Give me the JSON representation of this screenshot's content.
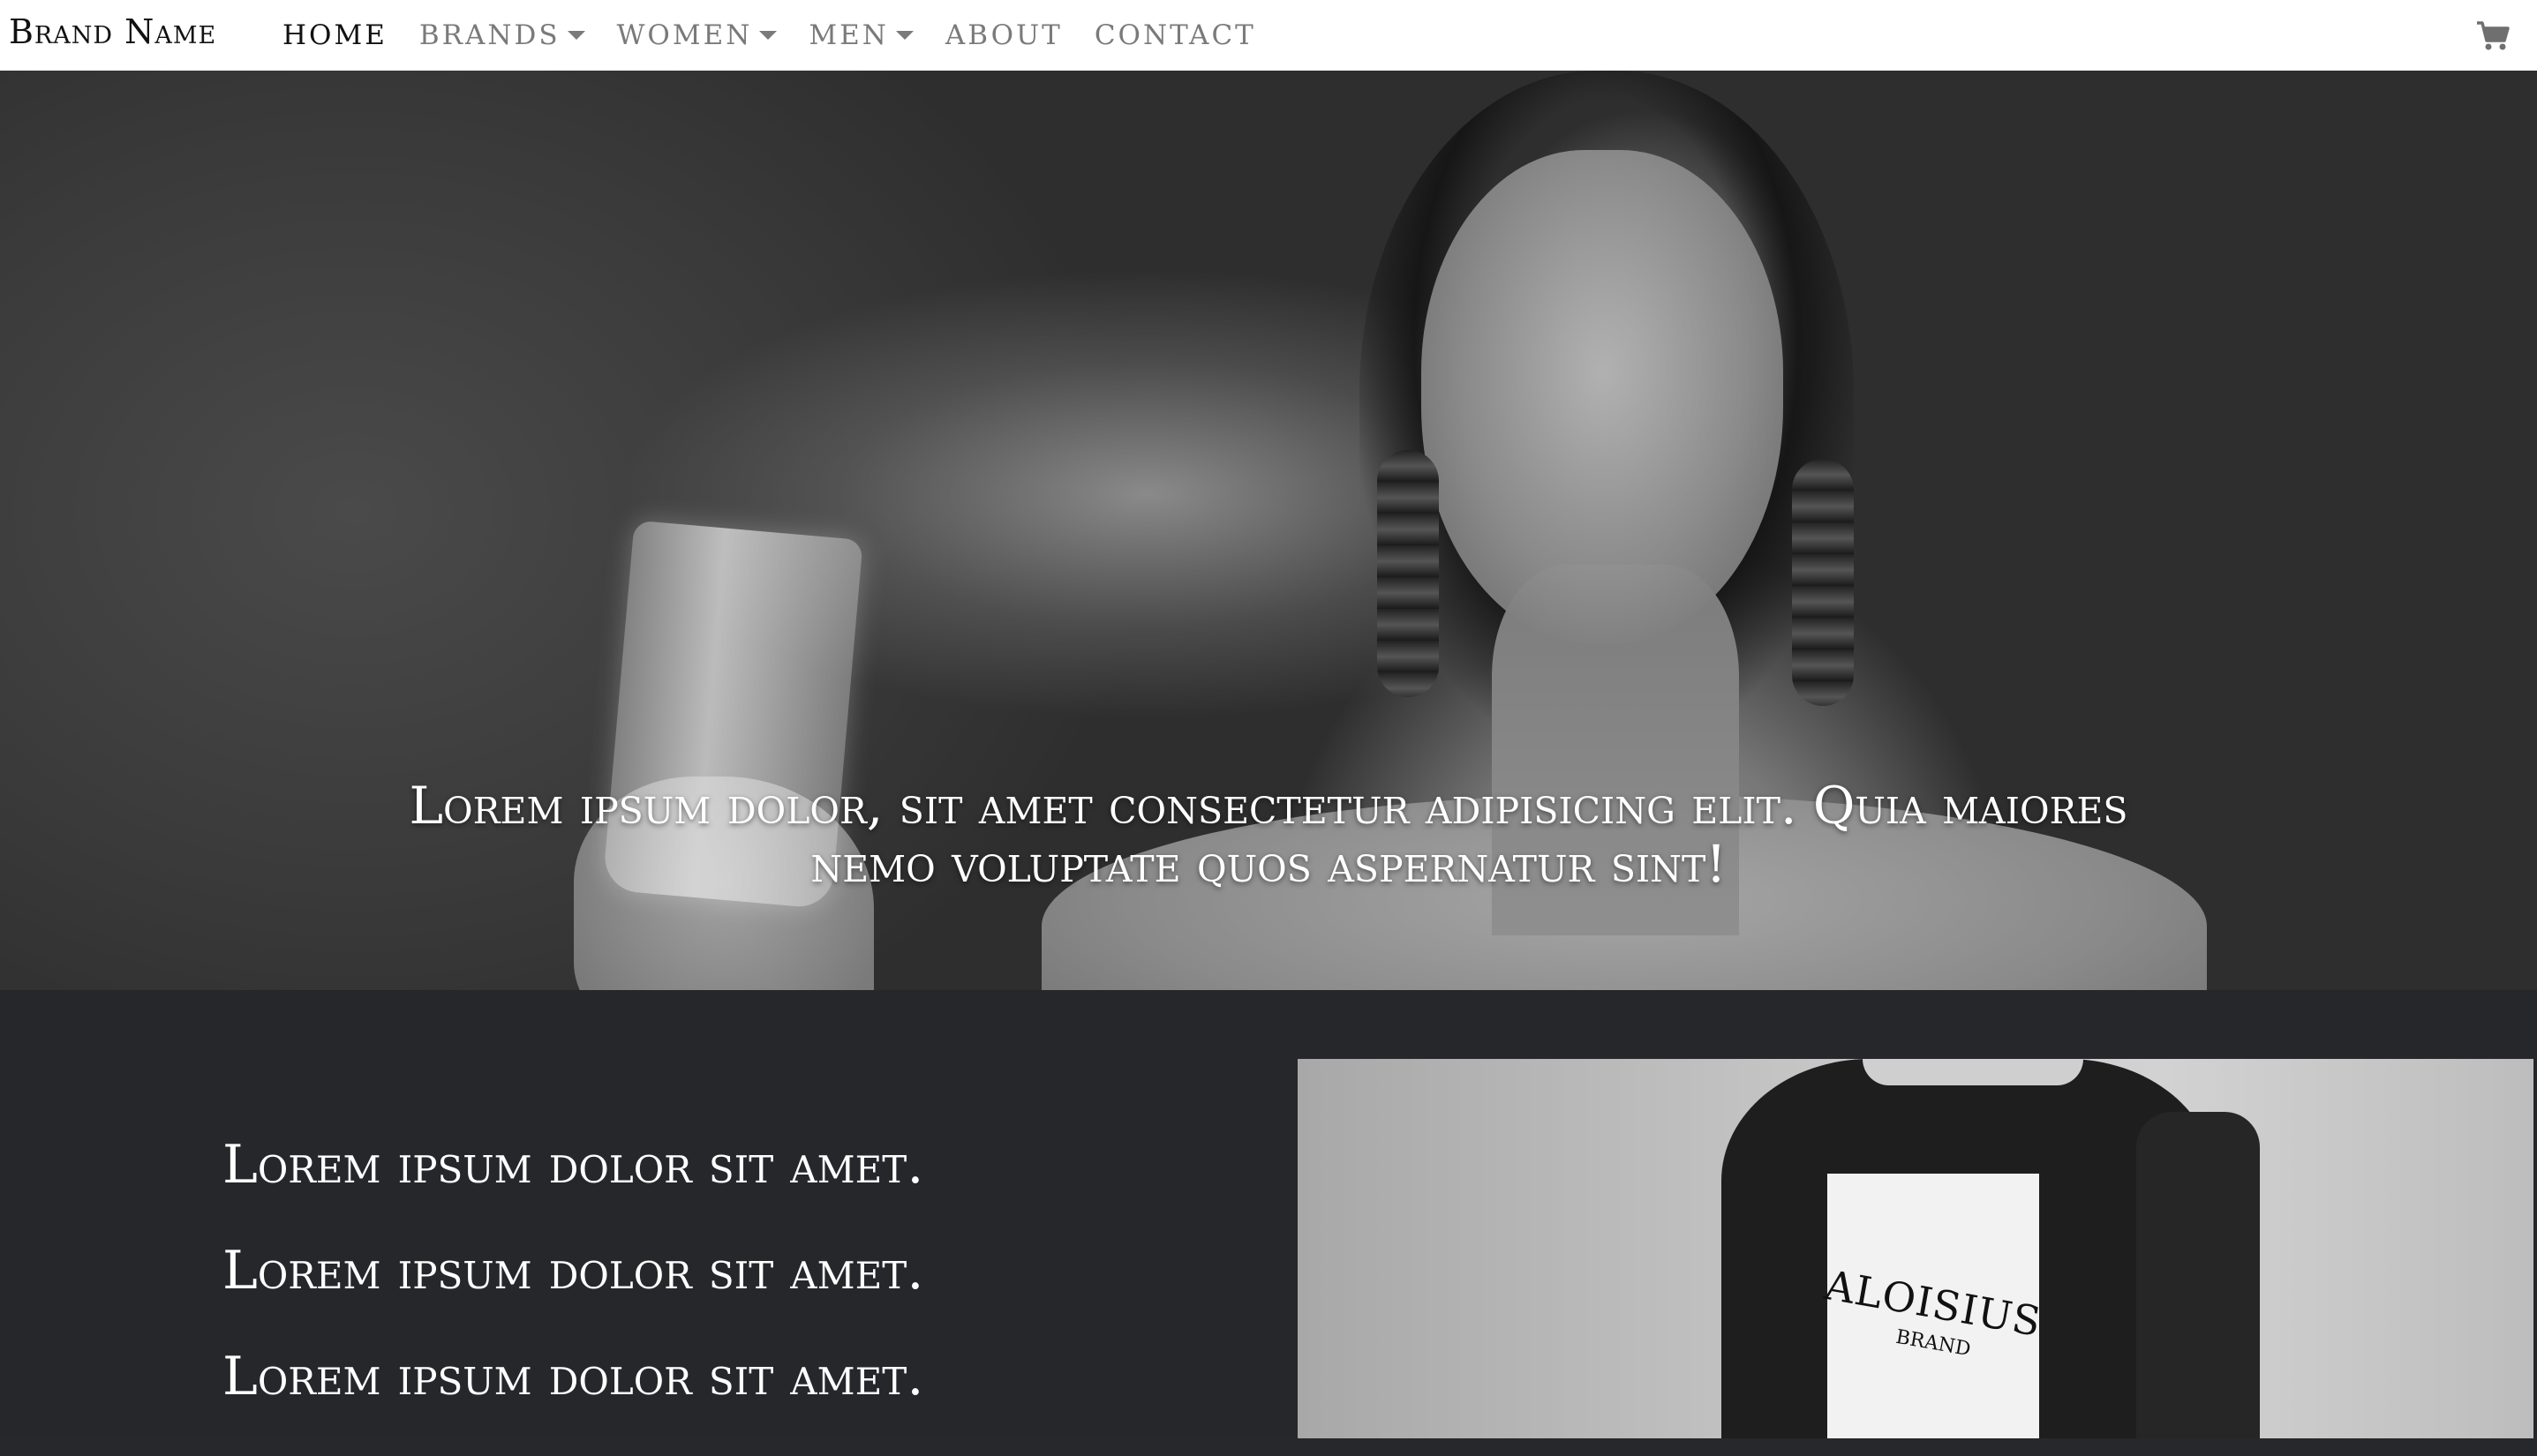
{
  "navbar": {
    "brand": "Brand Name",
    "items": [
      {
        "label": "HOME",
        "active": true,
        "dropdown": false
      },
      {
        "label": "BRANDS",
        "active": false,
        "dropdown": true
      },
      {
        "label": "WOMEN",
        "active": false,
        "dropdown": true
      },
      {
        "label": "MEN",
        "active": false,
        "dropdown": true
      },
      {
        "label": "ABOUT",
        "active": false,
        "dropdown": false
      },
      {
        "label": "CONTACT",
        "active": false,
        "dropdown": false
      }
    ],
    "cart_icon": "shopping-cart-icon"
  },
  "hero": {
    "text": "Lorem ipsum dolor, sit amet consectetur adipisicing elit. Quia maiores nemo voluptate quos aspernatur sint!"
  },
  "features": {
    "lines": [
      "Lorem ipsum dolor sit amet.",
      "Lorem ipsum dolor sit amet.",
      "Lorem ipsum dolor sit amet."
    ]
  },
  "product_image": {
    "print_main": "ALOISIUS",
    "print_sub": "BRAND"
  },
  "colors": {
    "navbar_bg": "#ffffff",
    "nav_active": "#111111",
    "nav_inactive": "#7a7a7a",
    "section_bg": "#25272a",
    "text_light": "#ffffff"
  }
}
